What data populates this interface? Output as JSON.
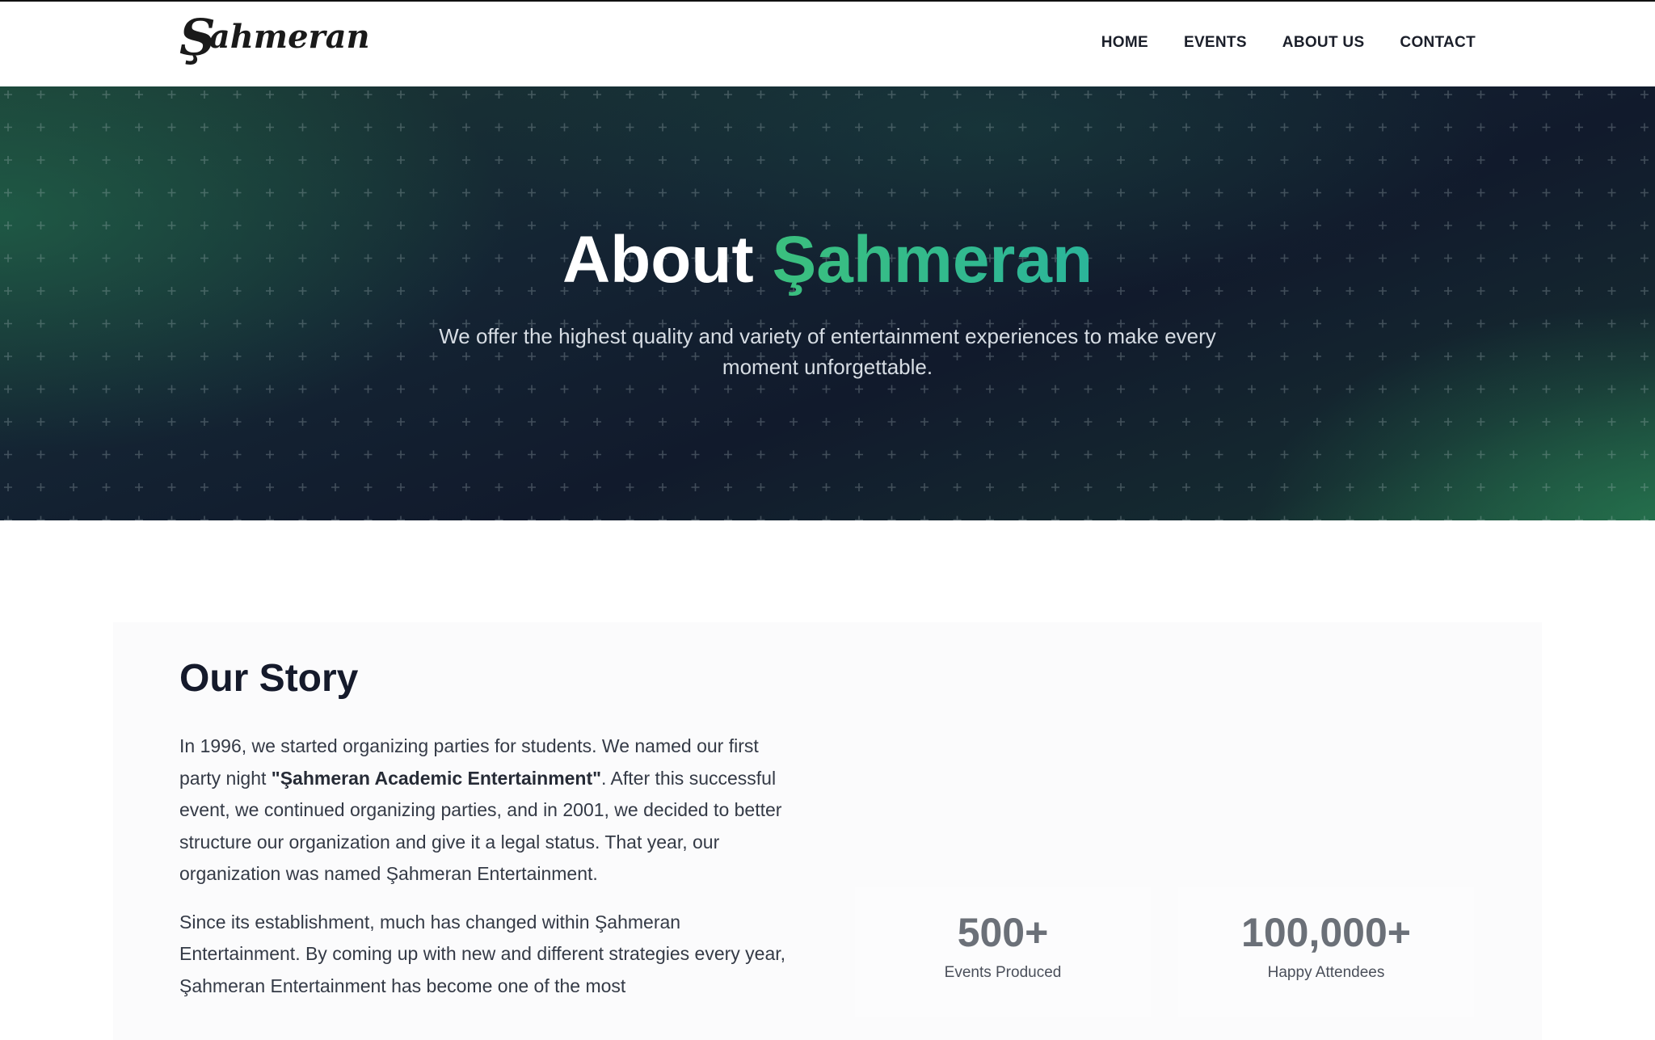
{
  "header": {
    "logo": {
      "first_letter": "Ş",
      "rest": "ahmeran"
    },
    "nav": [
      {
        "label": "HOME"
      },
      {
        "label": "EVENTS"
      },
      {
        "label": "ABOUT US"
      },
      {
        "label": "CONTACT"
      }
    ]
  },
  "hero": {
    "title_plain": "About",
    "title_accent": "Şahmeran",
    "subtitle": "We offer the highest quality and variety of entertainment experiences to make every moment unforgettable.",
    "colors": {
      "accent_start": "#3bbf7e",
      "accent_end": "#2bb59a",
      "background": "#111a2c"
    }
  },
  "story": {
    "title": "Our Story",
    "p1_before": "In 1996, we started organizing parties for students. We named our first party night ",
    "p1_bold": "\"Şahmeran Academic Entertainment\"",
    "p1_after": ". After this successful event, we continued organizing parties, and in 2001, we decided to better structure our organization and give it a legal status. That year, our organization was named Şahmeran Entertainment.",
    "p2": "Since its establishment, much has changed within Şahmeran Entertainment. By coming up with new and different strategies every year, Şahmeran Entertainment has become one of the most"
  },
  "stats": [
    {
      "value": "500+",
      "label": "Events Produced"
    },
    {
      "value": "100,000+",
      "label": "Happy Attendees"
    }
  ]
}
